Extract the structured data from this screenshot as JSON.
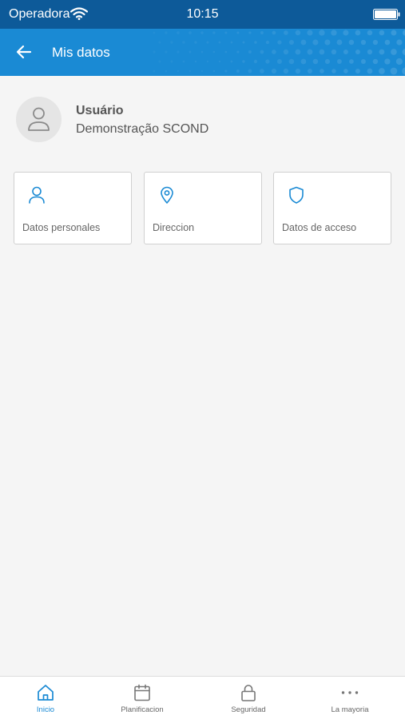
{
  "status_bar": {
    "carrier": "Operadora",
    "time": "10:15"
  },
  "header": {
    "title": "Mis datos",
    "back_icon": "arrow-left-icon"
  },
  "profile": {
    "name": "Usuário",
    "description": "Demonstração SCOND",
    "avatar_icon": "user-icon"
  },
  "cards": [
    {
      "label": "Datos personales",
      "icon": "user-icon"
    },
    {
      "label": "Direccion",
      "icon": "map-pin-icon"
    },
    {
      "label": "Datos de acceso",
      "icon": "shield-icon"
    }
  ],
  "bottom_nav": {
    "items": [
      {
        "label": "Inicio",
        "icon": "home-icon",
        "active": true
      },
      {
        "label": "Planificacion",
        "icon": "calendar-icon",
        "active": false
      },
      {
        "label": "Seguridad",
        "icon": "lock-icon",
        "active": false
      },
      {
        "label": "La mayoria",
        "icon": "more-icon",
        "active": false
      }
    ]
  },
  "colors": {
    "status_bar": "#0d5a99",
    "header": "#1a8ad4",
    "accent": "#1a8ad4",
    "background": "#f5f5f5"
  }
}
